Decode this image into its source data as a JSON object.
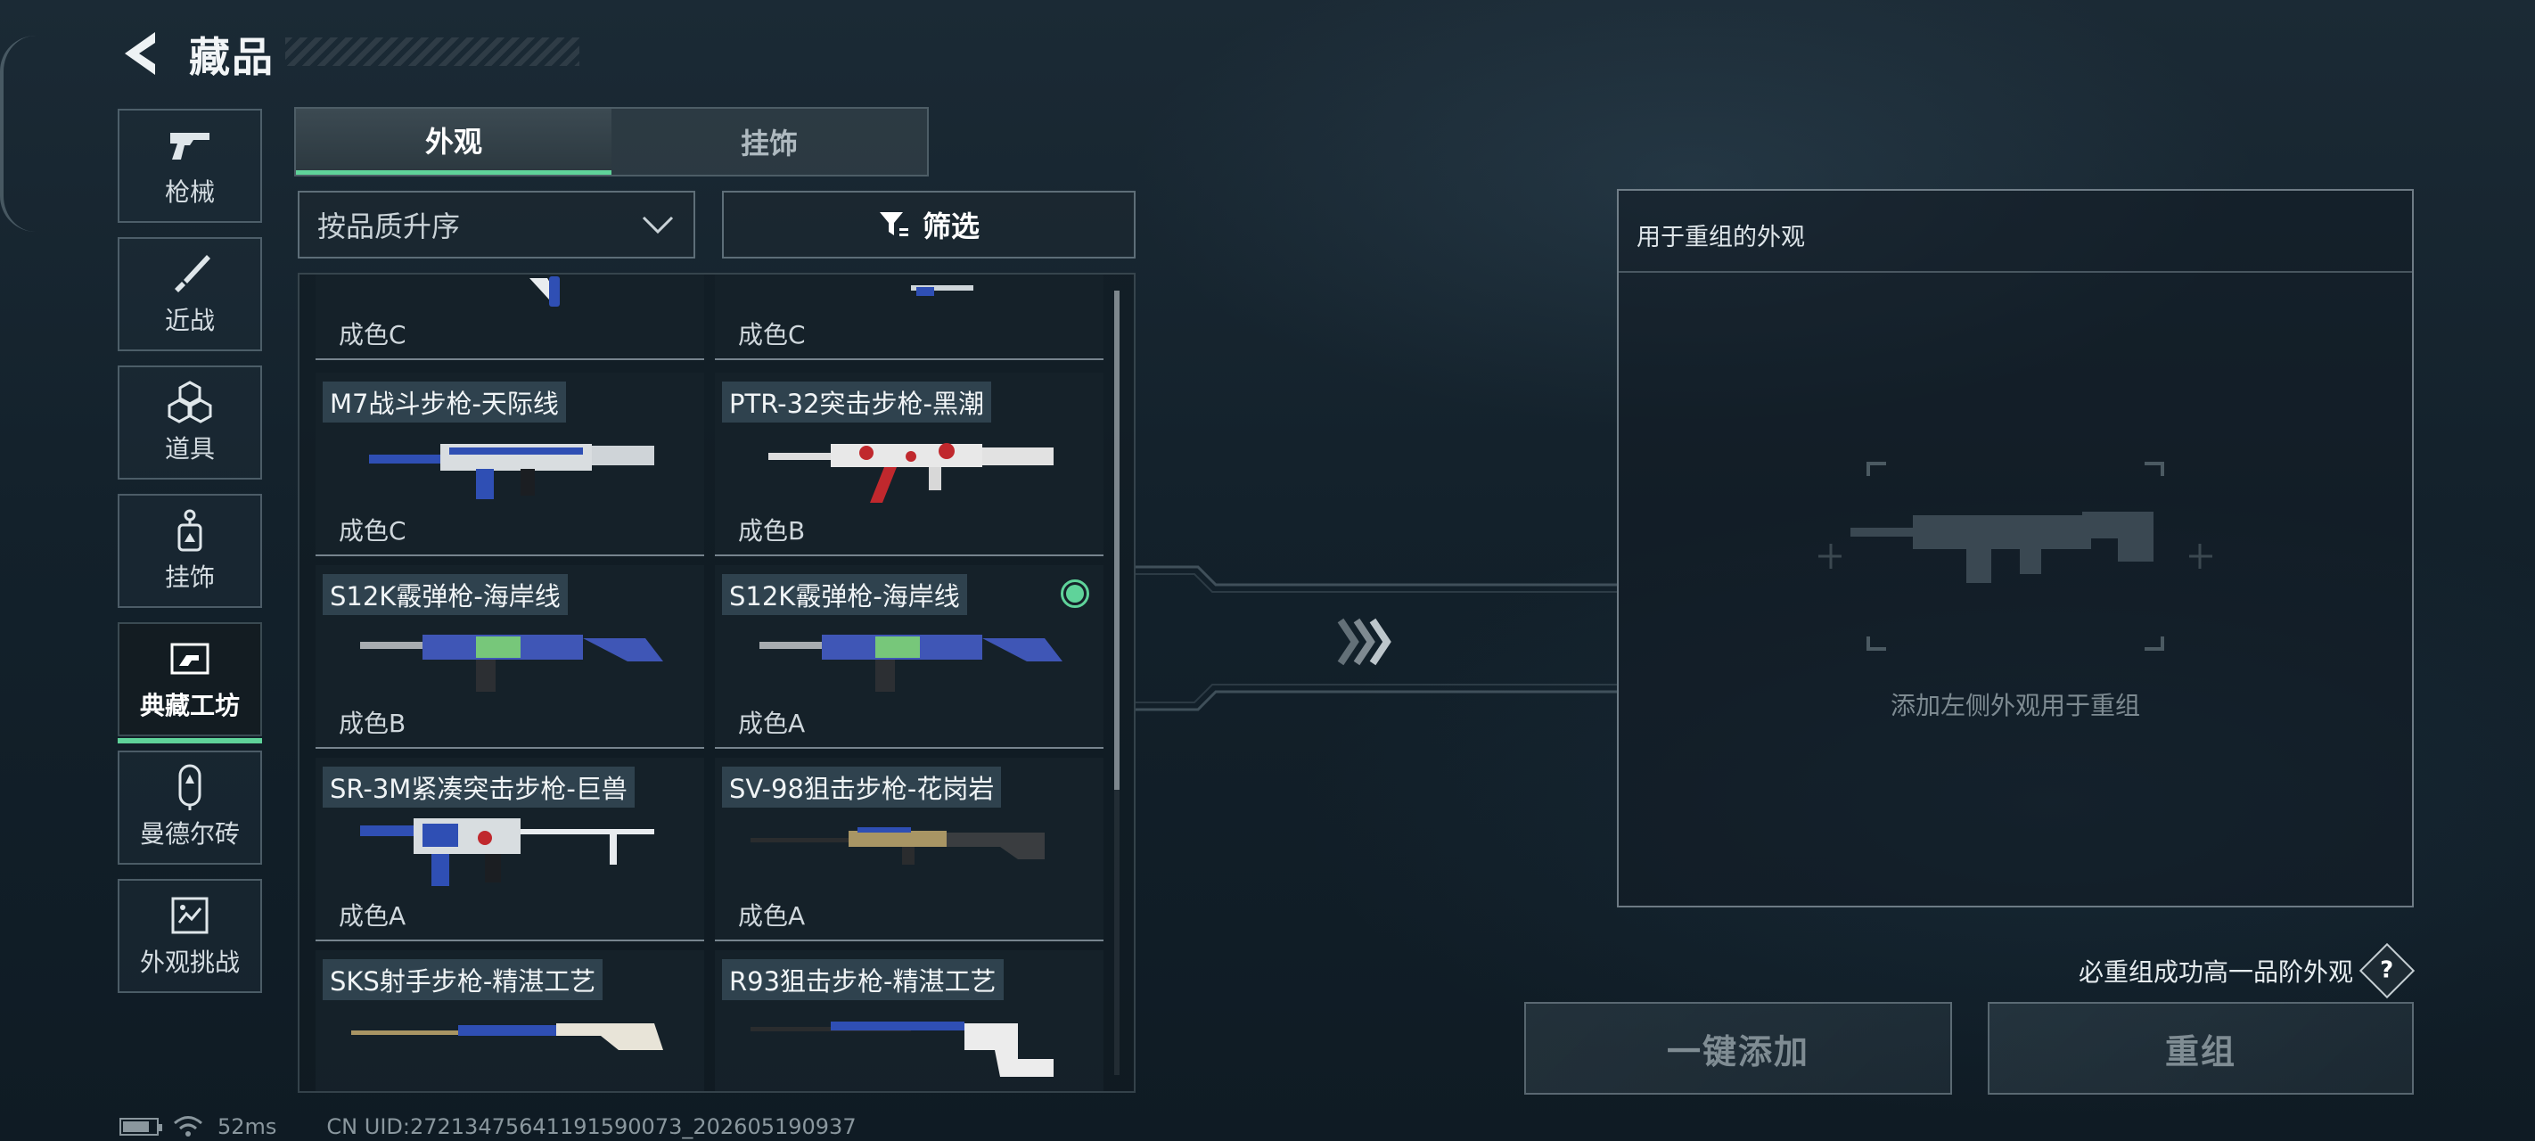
{
  "header": {
    "title": "藏品"
  },
  "side_nav": [
    {
      "label": "枪械",
      "icon": "pistol-icon",
      "active": false
    },
    {
      "label": "近战",
      "icon": "knife-icon",
      "active": false
    },
    {
      "label": "道具",
      "icon": "cubes-icon",
      "active": false
    },
    {
      "label": "挂饰",
      "icon": "charm-icon",
      "active": false
    },
    {
      "label": "典藏工坊",
      "icon": "workshop-icon",
      "active": true
    },
    {
      "label": "曼德尔砖",
      "icon": "brick-icon",
      "active": false
    },
    {
      "label": "外观挑战",
      "icon": "challenge-icon",
      "active": false
    }
  ],
  "tabs": [
    {
      "label": "外观",
      "active": true
    },
    {
      "label": "挂饰",
      "active": false
    }
  ],
  "sort": {
    "value": "按品质升序"
  },
  "filter": {
    "label": "筛选"
  },
  "items": [
    {
      "name": "",
      "grade": "成色C",
      "partial": true
    },
    {
      "name": "",
      "grade": "成色C",
      "partial": true
    },
    {
      "name": "M7战斗步枪-天际线",
      "grade": "成色C",
      "skin": "skyline"
    },
    {
      "name": "PTR-32突击步枪-黑潮",
      "grade": "成色B",
      "skin": "blood"
    },
    {
      "name": "S12K霰弹枪-海岸线",
      "grade": "成色B",
      "skin": "coast"
    },
    {
      "name": "S12K霰弹枪-海岸线",
      "grade": "成色A",
      "skin": "coast",
      "selected": true
    },
    {
      "name": "SR-3M紧凑突击步枪-巨兽",
      "grade": "成色A",
      "skin": "beast"
    },
    {
      "name": "SV-98狙击步枪-花岗岩",
      "grade": "成色A",
      "skin": "granite"
    },
    {
      "name": "SKS射手步枪-精湛工艺",
      "grade": "",
      "skin": "craft"
    },
    {
      "name": "R93狙击步枪-精湛工艺",
      "grade": "",
      "skin": "craft2"
    }
  ],
  "panel": {
    "title": "用于重组的外观",
    "hint": "添加左侧外观用于重组"
  },
  "guarantee": {
    "text": "必重组成功高一品阶外观",
    "help": "?"
  },
  "buttons": {
    "add_all": "一键添加",
    "recombine": "重组"
  },
  "status": {
    "ping": "52ms",
    "uid": "CN UID:272134756411915900​73_202605190937"
  },
  "colors": {
    "accent": "#5fd39a",
    "blue": "#2f4fb4"
  }
}
